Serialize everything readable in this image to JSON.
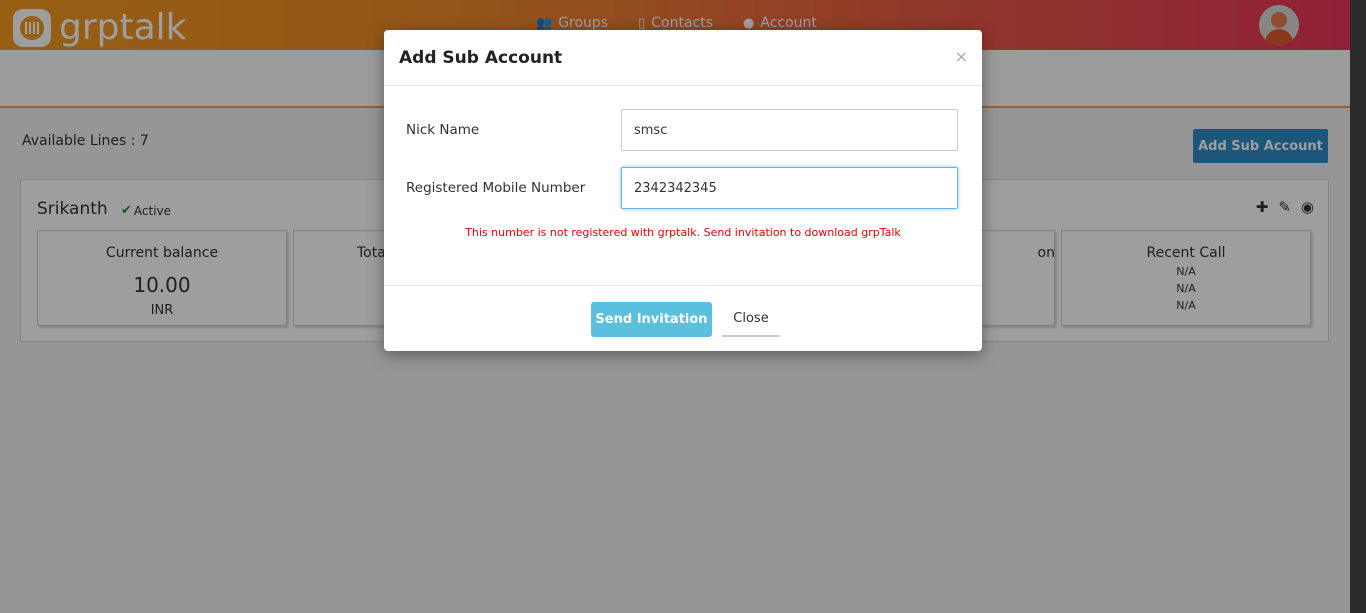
{
  "brand": {
    "name": "grptalk"
  },
  "nav": [
    {
      "label": "Groups",
      "icon": "users-icon"
    },
    {
      "label": "Contacts",
      "icon": "phone-icon"
    },
    {
      "label": "Account",
      "icon": "user-icon"
    }
  ],
  "available_lines": {
    "text": "Available Lines : 7"
  },
  "add_sub_account_button": "Add Sub Account",
  "account": {
    "name": "Srikanth",
    "status": "Active",
    "stats": [
      {
        "title": "Current balance",
        "value": "10.00",
        "unit": "INR"
      },
      {
        "title": "Tota"
      },
      {
        "title": "on"
      },
      {
        "title": "Recent Call",
        "lines": [
          "N/A",
          "N/A",
          "N/A"
        ]
      }
    ]
  },
  "modal": {
    "title": "Add Sub Account",
    "close_symbol": "×",
    "nick_name_label": "Nick Name",
    "nick_name_value": "smsc",
    "mobile_label": "Registered Mobile Number",
    "mobile_value": "2342342345",
    "error": "This number is not registered with grptalk. Send invitation to download grpTalk",
    "send_button": "Send Invitation",
    "close_button": "Close"
  }
}
